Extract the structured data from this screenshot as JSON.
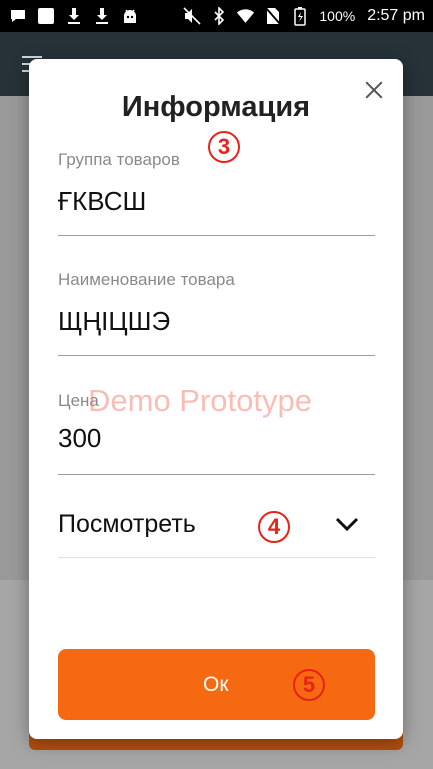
{
  "status_bar": {
    "battery_percent": "100%",
    "time": "2:57 pm",
    "left_icons": [
      "notification-icon",
      "notification-square-icon",
      "download-icon",
      "download-icon",
      "android-icon"
    ],
    "right_icons": [
      "mute-icon",
      "bluetooth-icon",
      "wifi-icon",
      "no-sim-icon",
      "battery-charging-icon"
    ]
  },
  "dialog": {
    "title": "Информация",
    "fields": [
      {
        "label": "Группа товаров",
        "value": "ҒКВСШ"
      },
      {
        "label": "Наименование товара",
        "value": "ЩҢІЦШЭ"
      },
      {
        "label": "Цена",
        "value": "300"
      }
    ],
    "view_label": "Посмотреть",
    "ok_label": "Ок"
  },
  "annotations": {
    "step_3": "3",
    "step_4": "4",
    "step_5": "5",
    "watermark": "Demo Prototype"
  },
  "colors": {
    "accent": "#f56a10",
    "app_bar": "#263238",
    "step_marker": "#e8221a"
  }
}
